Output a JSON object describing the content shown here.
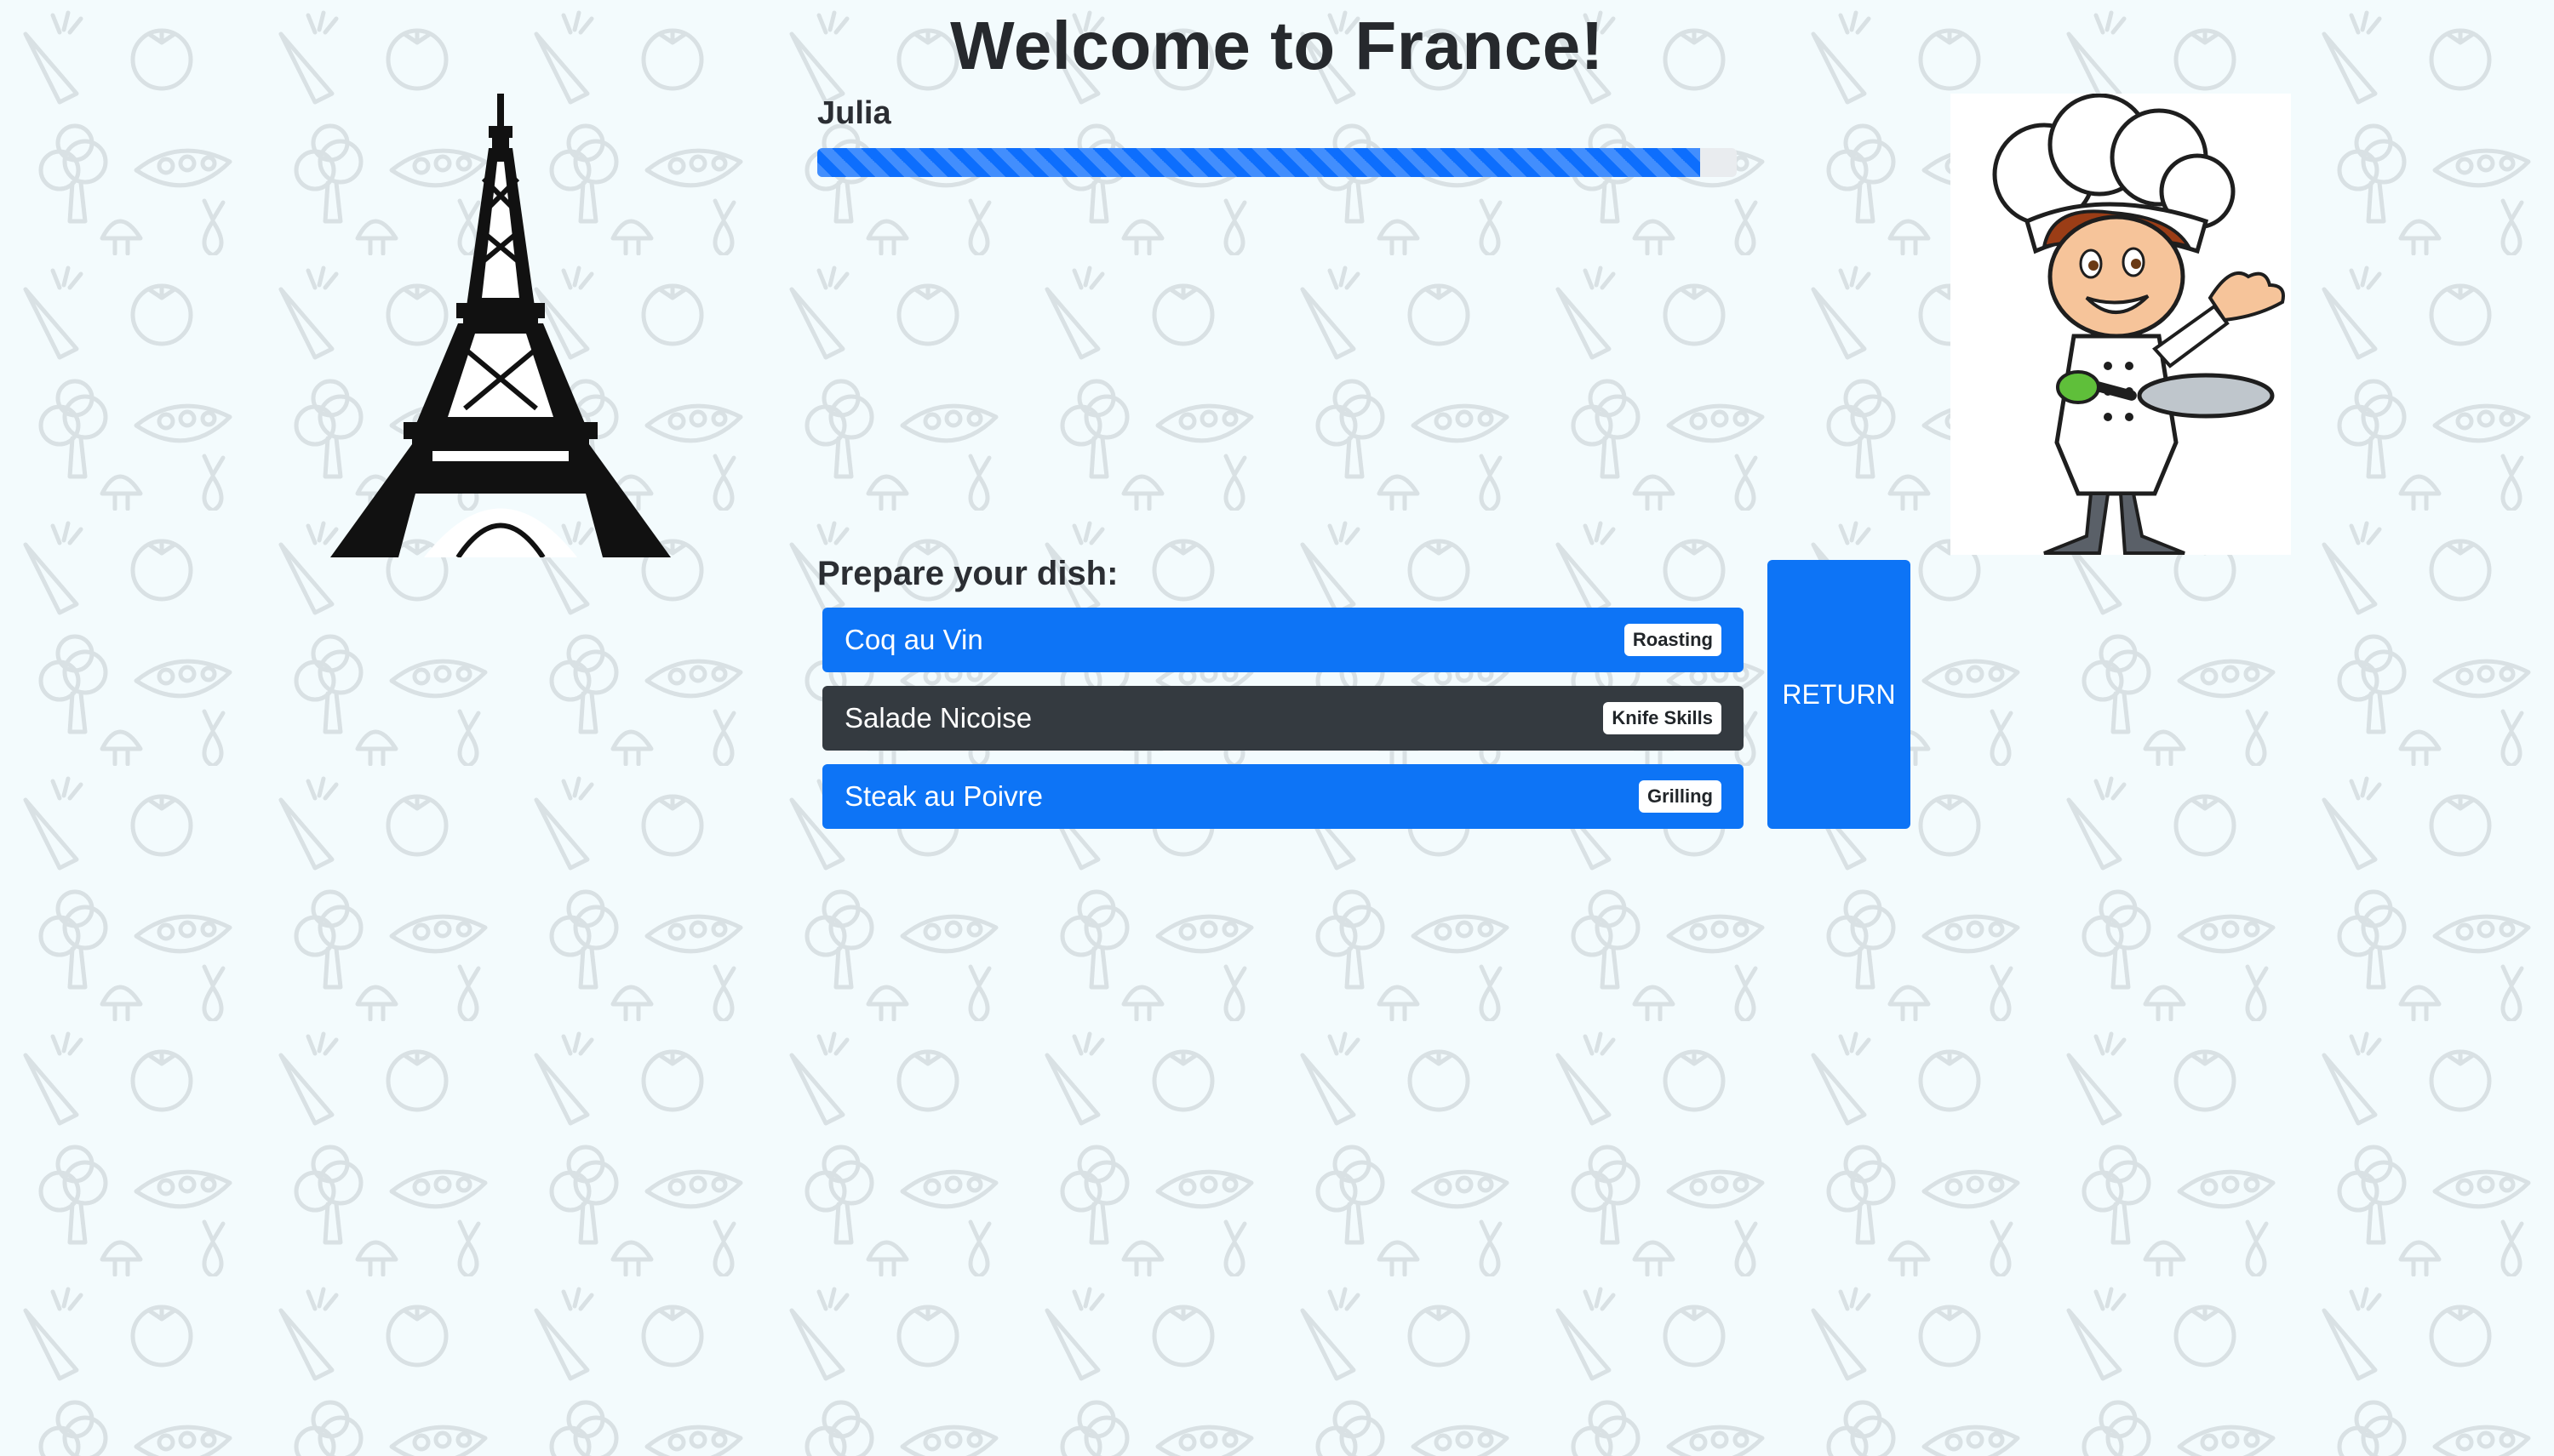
{
  "page": {
    "title": "Welcome to France!",
    "background_color": "#f3fbfd"
  },
  "player": {
    "name": "Julia",
    "progress_percent": 96
  },
  "dishes": {
    "heading": "Prepare your dish:",
    "items": [
      {
        "name": "Coq au Vin",
        "skill": "Roasting",
        "style": "primary"
      },
      {
        "name": "Salade Nicoise",
        "skill": "Knife Skills",
        "style": "dark"
      },
      {
        "name": "Steak au Poivre",
        "skill": "Grilling",
        "style": "primary"
      }
    ]
  },
  "actions": {
    "return_label": "RETURN"
  },
  "images": {
    "left": "eiffel-tower-icon",
    "right": "chef-illustration"
  },
  "colors": {
    "primary": "#0d74f6",
    "dark": "#343a40",
    "text": "#212529"
  }
}
